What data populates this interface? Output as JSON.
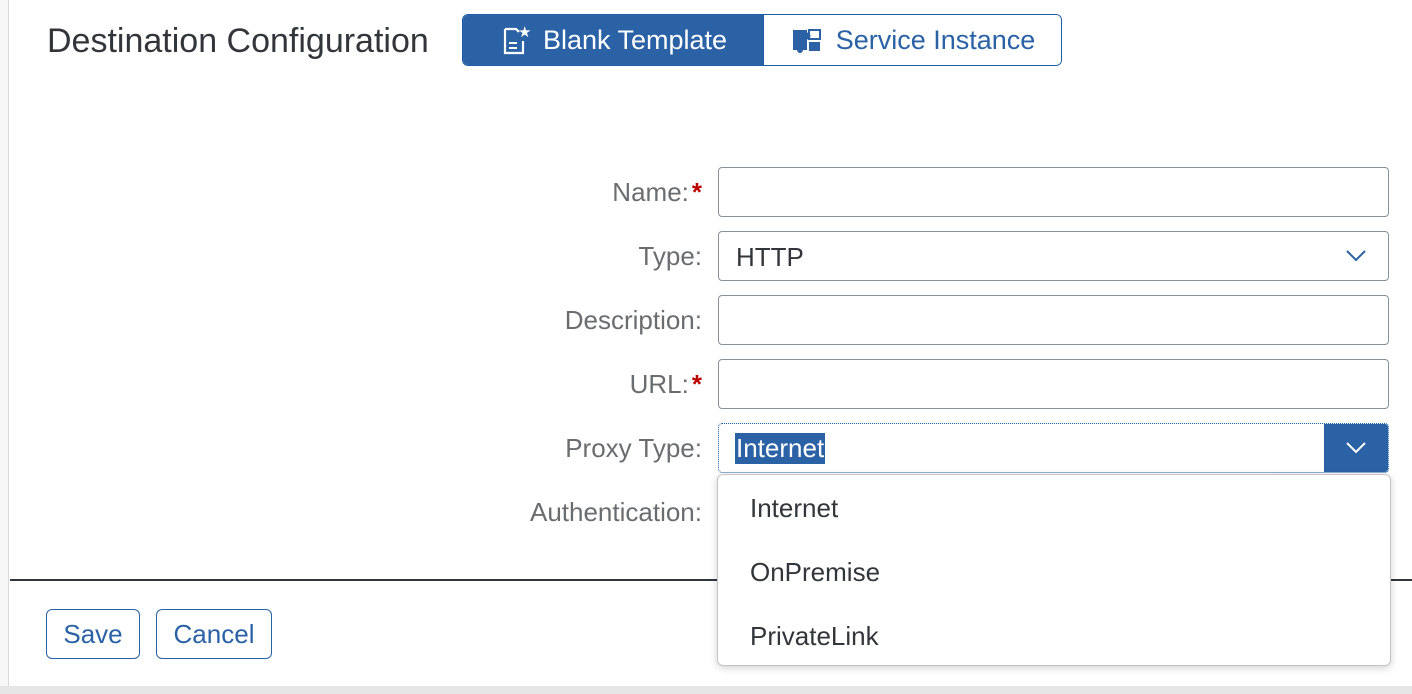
{
  "header": {
    "title": "Destination Configuration",
    "segments": [
      {
        "label": "Blank Template",
        "icon": "template-icon",
        "selected": true
      },
      {
        "label": "Service Instance",
        "icon": "service-instance-icon",
        "selected": false
      }
    ]
  },
  "form": {
    "name": {
      "label": "Name:",
      "required_mark": "*",
      "value": ""
    },
    "type": {
      "label": "Type:",
      "value": "HTTP"
    },
    "description": {
      "label": "Description:",
      "value": ""
    },
    "url": {
      "label": "URL:",
      "required_mark": "*",
      "value": ""
    },
    "proxy_type": {
      "label": "Proxy Type:",
      "value": "Internet"
    },
    "authentication": {
      "label": "Authentication:"
    }
  },
  "dropdown": {
    "options": [
      "Internet",
      "OnPremise",
      "PrivateLink"
    ]
  },
  "footer": {
    "save_label": "Save",
    "cancel_label": "Cancel"
  },
  "colors": {
    "accent": "#2b62a6",
    "required": "#bb0000",
    "label": "#6a6d70"
  }
}
